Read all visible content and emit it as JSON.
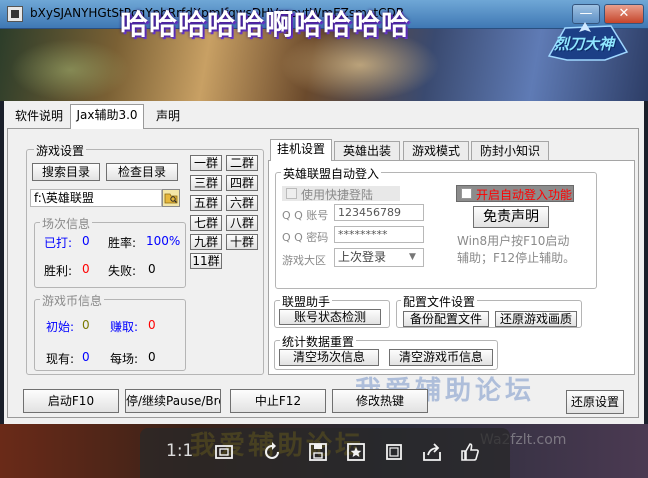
{
  "window": {
    "title": "bXySJANYHGtStPcqYpbRrfdXpmJfqwsDHVreoytWmEZsmctCDB",
    "minimize_symbol": "—",
    "close_symbol": "✕"
  },
  "banner": {
    "title": "哈哈哈哈哈啊哈哈哈哈",
    "logo_text": "烈刀大神"
  },
  "main_tabs": [
    "软件说明",
    "Jax辅助3.0",
    "声明"
  ],
  "left": {
    "game_settings": {
      "title": "游戏设置",
      "search_dir_label": "搜索目录",
      "check_dir_label": "检查目录",
      "path_value": "f:\\英雄联盟",
      "folder_icon": "folder-icon"
    },
    "groups": [
      "一群",
      "二群",
      "三群",
      "四群",
      "五群",
      "六群",
      "七群",
      "八群",
      "九群",
      "十群",
      "11群"
    ],
    "match_info": {
      "title": "场次信息",
      "played_label": "已打:",
      "played_value": "0",
      "winrate_label": "胜率:",
      "winrate_value": "100%",
      "wins_label": "胜利:",
      "wins_value": "0",
      "losses_label": "失败:",
      "losses_value": "0"
    },
    "coin_info": {
      "title": "游戏币信息",
      "initial_label": "初始:",
      "initial_value": "0",
      "earned_label": "赚取:",
      "earned_value": "0",
      "current_label": "现有:",
      "current_value": "0",
      "per_match_label": "每场:",
      "per_match_value": "0"
    }
  },
  "right": {
    "sub_tabs": [
      "挂机设置",
      "英雄出装",
      "游戏模式",
      "防封小知识"
    ],
    "auto_login": {
      "title": "英雄联盟自动登入",
      "quick_login_label": "使用快捷登陆",
      "qq_account_label": "Q Q 账号",
      "qq_account_value": "123456789",
      "qq_password_label": "Q Q 密码",
      "qq_password_value": "*********",
      "region_label": "游戏大区",
      "region_value": "上次登录",
      "enable_auto_login_label": "开启自动登入功能",
      "disclaimer_label": "免责声明",
      "hint_line1": "Win8用户按F10启动",
      "hint_line2": "辅助；F12停止辅助。"
    },
    "alliance_helper": {
      "title": "联盟助手",
      "status_check_label": "账号状态检测"
    },
    "config_file": {
      "title": "配置文件设置",
      "backup_label": "备份配置文件",
      "restore_label": "还原游戏画质"
    },
    "stats_reset": {
      "title": "统计数据重置",
      "clear_match_label": "清空场次信息",
      "clear_coin_label": "清空游戏币信息"
    }
  },
  "bottom_buttons": {
    "start": "启动F10",
    "pause": "停/继续Pause/Bre",
    "stop": "中止F12",
    "hotkey": "修改热键",
    "restore": "还原设置"
  },
  "viewer_overlay": {
    "ratio": "1:1",
    "icons": [
      "fit-screen-icon",
      "rotate-icon",
      "save-icon",
      "favorite-icon",
      "crop-icon",
      "share-icon",
      "like-icon"
    ]
  },
  "watermarks": {
    "forum": "我爱辅助论坛",
    "site": "Wa2fzlt.com"
  }
}
